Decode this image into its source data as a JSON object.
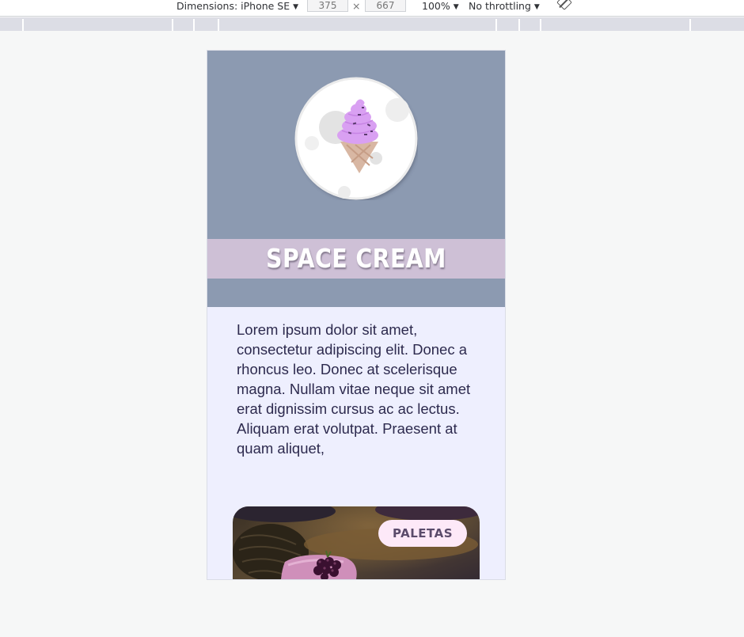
{
  "devtools": {
    "dimensions_label": "Dimensions: iPhone SE",
    "width": "375",
    "times": "×",
    "height": "667",
    "zoom": "100%",
    "throttling": "No throttling",
    "caret": "▼",
    "rotate_icon": "rotate-icon"
  },
  "page": {
    "brand_title": "SPACE CREAM",
    "logo_icon": "ice-cream-cone-icon",
    "intro_text": "Lorem ipsum dolor sit amet, consectetur adipiscing elit. Donec a rhoncus leo. Donec at scelerisque magna. Nullam vitae neque sit amet erat dignissim cursus ac ac lectus. Aliquam erat volutpat. Praesent at quam aliquet,",
    "card_label": "PALETAS",
    "card_image": "popsicle-with-blackberry-photo"
  },
  "colors": {
    "hero_bg": "#8c9ab1",
    "band_bg": "#cec0d6",
    "content_bg": "#eeeffe",
    "text": "#2d2a4e",
    "badge_bg": "#fde9f8",
    "ice_cream": "#d9a0f2"
  }
}
